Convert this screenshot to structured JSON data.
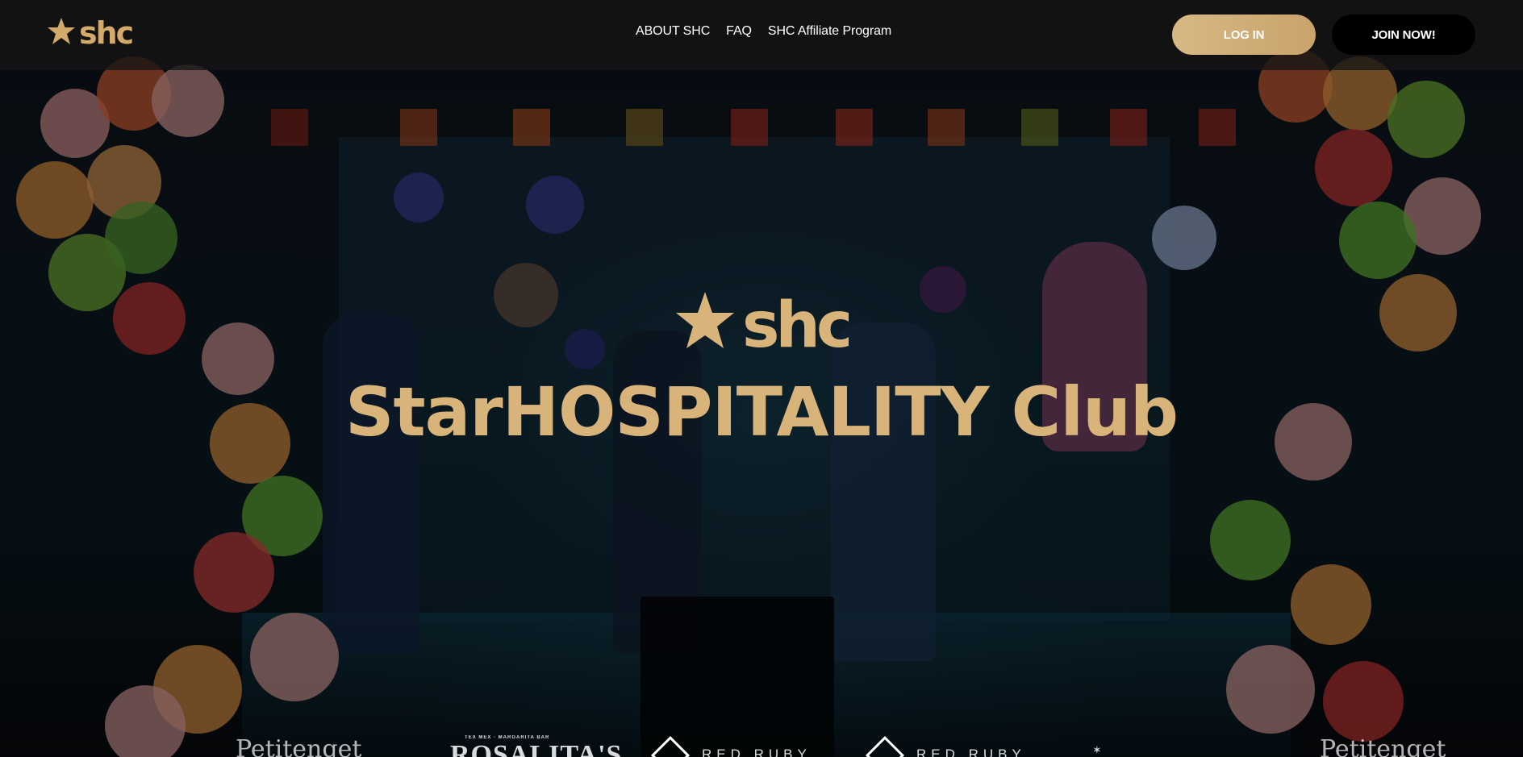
{
  "header": {
    "logo_text": "shc",
    "nav": [
      {
        "label": "ABOUT SHC"
      },
      {
        "label": "FAQ"
      },
      {
        "label": "SHC Affiliate Program"
      }
    ],
    "login_label": "LOG IN",
    "join_label": "JOIN NOW!"
  },
  "hero": {
    "logo_text": "shc",
    "title": "StarHOSPITALITY Club"
  },
  "partners": {
    "items": [
      {
        "name": "Petitenget"
      },
      {
        "name": "ROSALITA'S",
        "tagline": "TEX MEX · MARGARITA BAR"
      },
      {
        "name": "RED RUBY"
      },
      {
        "name": "RED RUBY"
      },
      {
        "name": "Petitenget"
      }
    ]
  },
  "colors": {
    "gold": "#d8b47a",
    "login_gradient_start": "#d7b885",
    "login_gradient_end": "#c9a36b",
    "join_bg": "#000000",
    "header_bg": "#161414"
  },
  "icons": {
    "logo": "star-shc-logo-icon",
    "partner_mark": "red-ruby-diamond-icon"
  }
}
